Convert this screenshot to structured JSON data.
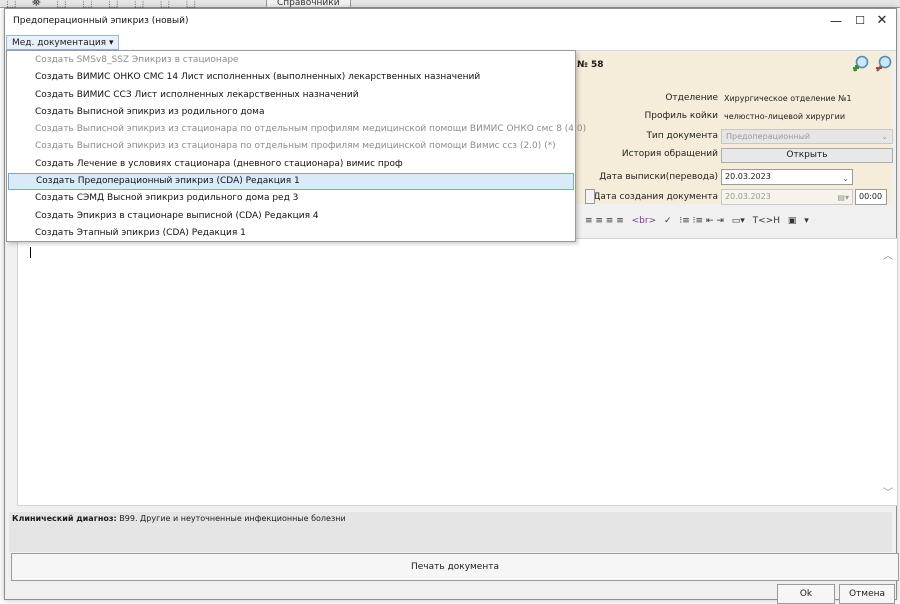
{
  "background": {
    "toolbar_tab": "Справочники",
    "toolbar_glyphs": "⬚ ⛯ ⬚ ⬚ ⬚ ⬚ ⬚ ⬚"
  },
  "window": {
    "title": "Предоперационный эпикриз (новый)",
    "minimize_glyph": "—",
    "maximize_glyph": "☐",
    "close_glyph": "✕"
  },
  "menubar": {
    "med_docs_label": "Мед. документация ▾"
  },
  "dropdown": {
    "items": [
      {
        "label": "Создать SMSv8_SSZ Эпикриз в стационаре",
        "enabled": false
      },
      {
        "label": "Создать ВИМИС ОНКО СМС 14 Лист исполненных (выполненных) лекарственных назначений",
        "enabled": true
      },
      {
        "label": "Создать ВИМИС ССЗ Лист исполненных лекарственных назначений",
        "enabled": true
      },
      {
        "label": "Создать Выписной эпикриз из родильного дома",
        "enabled": true
      },
      {
        "label": "Создать Выписной эпикриз из стационара по отдельным профилям медицинской помощи ВИМИС ОНКО смс 8 (4.0)",
        "enabled": false
      },
      {
        "label": "Создать Выписной эпикриз из стационара по отдельным профилям медицинской помощи Вимис ссз (2.0) (*)",
        "enabled": false
      },
      {
        "label": "Создать Лечение в условиях стационара (дневного стационара) вимис проф",
        "enabled": true
      },
      {
        "label": "Создать Предоперационный эпикриз (CDA) Редакция 1",
        "enabled": true,
        "selected": true
      },
      {
        "label": "Создать СЭМД Высной эпикриз родильного дома ред 3",
        "enabled": true
      },
      {
        "label": "Создать Эпикриз в стационаре выписной (CDA) Редакция 4",
        "enabled": true
      },
      {
        "label": "Создать Этапный эпикриз (CDA) Редакция 1",
        "enabled": true
      }
    ]
  },
  "header": {
    "doc_number": "№ 58",
    "department_label": "Отделение",
    "department_value": "Хирургическое отделение №1",
    "bed_profile_label": "Профиль койки",
    "bed_profile_value": "челюстно-лицевой хирургии",
    "doc_type_label": "Тип документа",
    "doc_type_value": "Предоперационный",
    "history_label": "История обращений",
    "open_button": "Открыть",
    "discharge_date_label": "Дата выписки(перевода)",
    "discharge_date_value": "20.03.2023",
    "creation_date_label": "Дата создания документа",
    "creation_date_value": "20.03.2023",
    "creation_time_value": "00:00"
  },
  "editor_toolbar": {
    "align_icons": "≡ ≡ ≡ ≡",
    "br_tag": "<br>",
    "list_icons": "⁝≡ ⁝≡ ⇤ ⇥",
    "text_tag": "T<>H"
  },
  "diagnosis": {
    "label": "Клинический диагноз:",
    "value": "B99. Другие и неуточненные инфекционные болезни"
  },
  "buttons": {
    "print": "Печать документа",
    "ok": "Ok",
    "cancel": "Отмена"
  },
  "colors": {
    "header_bg": "#f5ecd9",
    "selected_item_bg": "#dbeaf8",
    "selected_item_border": "#7aa7d6"
  }
}
